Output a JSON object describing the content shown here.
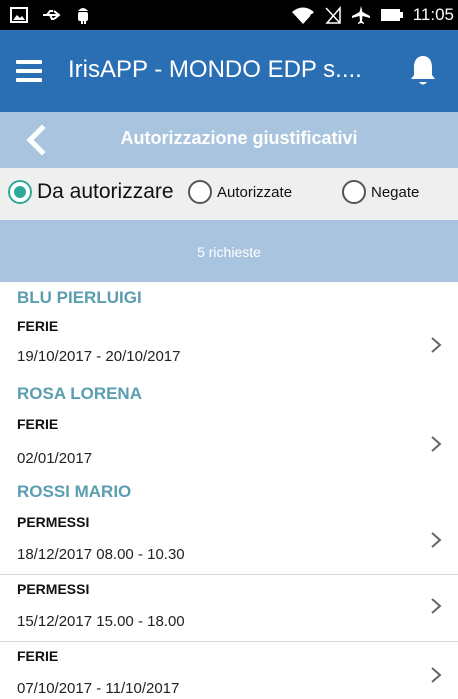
{
  "status_bar": {
    "time": "11:05",
    "icons_left": [
      "gallery-icon",
      "usb-icon",
      "android-debug-icon"
    ],
    "icons_right": [
      "wifi-icon",
      "no-sim-icon",
      "airplane-icon",
      "battery-icon"
    ]
  },
  "app_bar": {
    "title": "IrisAPP - MONDO EDP s....",
    "color": "#2a6fb4"
  },
  "sub_bar": {
    "title": "Autorizzazione giustificativi"
  },
  "filters": {
    "options": [
      {
        "label": "Da autorizzare",
        "selected": true
      },
      {
        "label": "Autorizzate",
        "selected": false
      },
      {
        "label": "Negate",
        "selected": false
      }
    ],
    "accent": "#2fa89a"
  },
  "summary": {
    "count_text": "5 richieste"
  },
  "groups": [
    {
      "name": "BLU PIERLUIGI",
      "requests": [
        {
          "type": "FERIE",
          "dates": "19/10/2017 - 20/10/2017"
        }
      ]
    },
    {
      "name": "ROSA LORENA",
      "requests": [
        {
          "type": "FERIE",
          "dates": "02/01/2017"
        }
      ]
    },
    {
      "name": "ROSSI MARIO",
      "requests": [
        {
          "type": "PERMESSI",
          "dates": "18/12/2017 08.00 - 10.30"
        },
        {
          "type": "PERMESSI",
          "dates": "15/12/2017 15.00 - 18.00"
        },
        {
          "type": "FERIE",
          "dates": "07/10/2017 - 11/10/2017"
        }
      ]
    }
  ]
}
